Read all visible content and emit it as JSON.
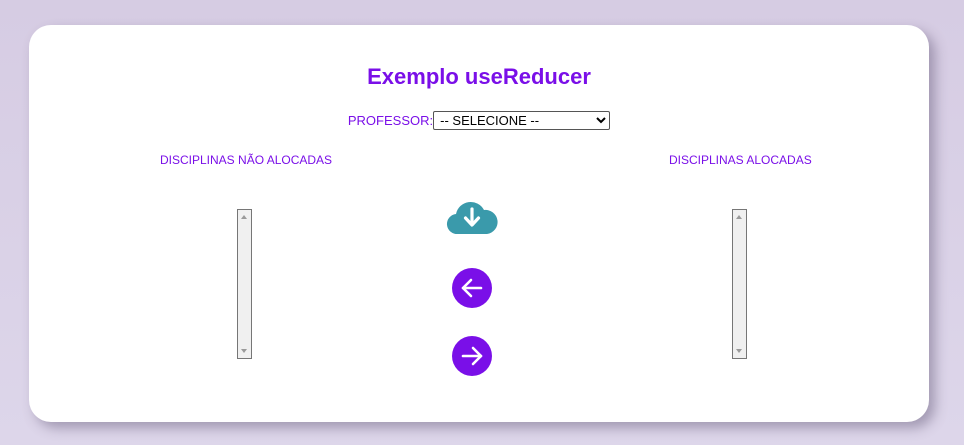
{
  "page": {
    "title": "Exemplo useReducer"
  },
  "professor": {
    "label": "PROFESSOR:",
    "selected": "-- SELECIONE --"
  },
  "columns": {
    "unallocated_label": "DISCIPLINAS NÃO ALOCADAS",
    "allocated_label": "DISCIPLINAS ALOCADAS"
  },
  "icons": {
    "load": "cloud-download-icon",
    "move_left": "arrow-left-icon",
    "move_right": "arrow-right-icon"
  },
  "colors": {
    "accent": "#7a0fe8",
    "cloud": "#3a9aab",
    "background": "#d8cfe5"
  }
}
